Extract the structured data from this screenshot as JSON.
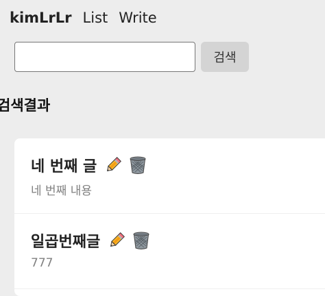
{
  "navbar": {
    "brand": "kimLrLr",
    "links": [
      "List",
      "Write"
    ]
  },
  "search": {
    "value": "",
    "placeholder": "",
    "button_label": "검색"
  },
  "results": {
    "heading": "검색결과",
    "items": [
      {
        "title": "네 번째 글",
        "content": "네 번째 내용",
        "edit_icon": "pencil-icon",
        "delete_icon": "wastebasket-icon"
      },
      {
        "title": "일곱번째글",
        "content": "777",
        "edit_icon": "pencil-icon",
        "delete_icon": "wastebasket-icon"
      }
    ]
  },
  "colors": {
    "page_background": "#ededed",
    "card_background": "#ffffff",
    "button_background": "#d4d4d4",
    "muted_text": "#808080"
  }
}
